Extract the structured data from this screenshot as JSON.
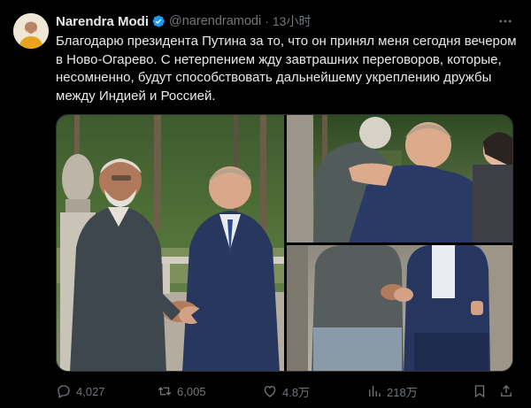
{
  "post": {
    "author": {
      "display_name": "Narendra Modi",
      "handle": "@narendramodi",
      "time": "13小时",
      "verified": true
    },
    "text": "Благодарю президента Путина за то, что он принял меня сегодня вечером в Ново-Огарево. С нетерпением жду завтрашних переговоров, которые, несомненно, будут способствовать дальнейшему укреплению дружбы между Индией и Россией.",
    "media": {
      "count": 3,
      "layout": "one-large-left-two-stacked-right"
    },
    "stats": {
      "replies": "4,027",
      "reposts": "6,005",
      "likes": "4.8万",
      "views": "218万"
    }
  },
  "colors": {
    "background": "#000000",
    "text": "#e7e9ea",
    "secondary": "#71767b",
    "verified": "#1d9bf0",
    "border": "#2f3336"
  },
  "icons": {
    "verified": "verified-badge-icon",
    "more": "more-horizontal-icon",
    "reply": "reply-icon",
    "repost": "repost-icon",
    "like": "heart-icon",
    "views": "views-icon",
    "bookmark": "bookmark-icon",
    "share": "share-icon"
  }
}
